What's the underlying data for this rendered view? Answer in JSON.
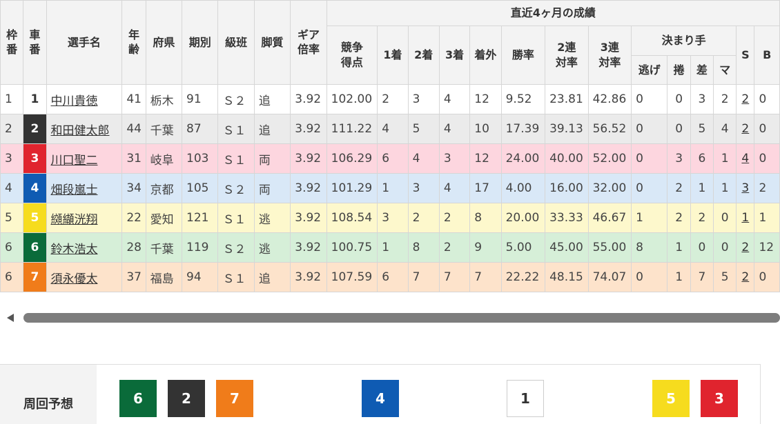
{
  "header": {
    "waku": "枠番",
    "sha": "車番",
    "name": "選手名",
    "age": "年齢",
    "pref": "府県",
    "term": "期別",
    "class": "級班",
    "style": "脚質",
    "gear": "ギア倍率",
    "recent": "直近4ヶ月の成績",
    "score": "競争得点",
    "first": "1着",
    "second": "2着",
    "third": "3着",
    "out": "着外",
    "win_rate": "勝率",
    "rate2": "2連対率",
    "rate3": "3連対率",
    "kimarite": "決まり手",
    "nige": "逃げ",
    "makuri": "捲",
    "sashi": "差",
    "ma": "マ",
    "s": "S",
    "b": "B"
  },
  "rows": [
    {
      "waku": "1",
      "car": "1",
      "name": "中川貴徳",
      "age": "41",
      "pref": "栃木",
      "term": "91",
      "class": "Ｓ２",
      "style": "追",
      "gear": "3.92",
      "score": "102.00",
      "p1": "2",
      "p2": "3",
      "p3": "4",
      "out": "12",
      "win": "9.52",
      "r2": "23.81",
      "r3": "42.86",
      "nige": "0",
      "makuri": "0",
      "sashi": "3",
      "ma": "2",
      "s": "2",
      "b": "0",
      "car_bg": "#ffffff",
      "car_fg": "#333333"
    },
    {
      "waku": "2",
      "car": "2",
      "name": "和田健太郎",
      "age": "44",
      "pref": "千葉",
      "term": "87",
      "class": "Ｓ１",
      "style": "追",
      "gear": "3.92",
      "score": "111.22",
      "p1": "4",
      "p2": "5",
      "p3": "4",
      "out": "10",
      "win": "17.39",
      "r2": "39.13",
      "r3": "56.52",
      "nige": "0",
      "makuri": "0",
      "sashi": "5",
      "ma": "4",
      "s": "2",
      "b": "0",
      "car_bg": "#333333",
      "car_fg": "#ffffff"
    },
    {
      "waku": "3",
      "car": "3",
      "name": "川口聖二",
      "age": "31",
      "pref": "岐阜",
      "term": "103",
      "class": "Ｓ１",
      "style": "両",
      "gear": "3.92",
      "score": "106.29",
      "p1": "6",
      "p2": "4",
      "p3": "3",
      "out": "12",
      "win": "24.00",
      "r2": "40.00",
      "r3": "52.00",
      "nige": "0",
      "makuri": "3",
      "sashi": "6",
      "ma": "1",
      "s": "4",
      "b": "0",
      "car_bg": "#e0242e",
      "car_fg": "#ffffff"
    },
    {
      "waku": "4",
      "car": "4",
      "name": "畑段嵐士",
      "age": "34",
      "pref": "京都",
      "term": "105",
      "class": "Ｓ２",
      "style": "両",
      "gear": "3.92",
      "score": "101.29",
      "p1": "1",
      "p2": "3",
      "p3": "4",
      "out": "17",
      "win": "4.00",
      "r2": "16.00",
      "r3": "32.00",
      "nige": "0",
      "makuri": "2",
      "sashi": "1",
      "ma": "1",
      "s": "3",
      "b": "2",
      "car_bg": "#0f5bb3",
      "car_fg": "#ffffff"
    },
    {
      "waku": "5",
      "car": "5",
      "name": "纐纈洸翔",
      "age": "22",
      "pref": "愛知",
      "term": "121",
      "class": "Ｓ１",
      "style": "逃",
      "gear": "3.92",
      "score": "108.54",
      "p1": "3",
      "p2": "2",
      "p3": "2",
      "out": "8",
      "win": "20.00",
      "r2": "33.33",
      "r3": "46.67",
      "nige": "1",
      "makuri": "2",
      "sashi": "2",
      "ma": "0",
      "s": "1",
      "b": "1",
      "car_bg": "#f6dc1e",
      "car_fg": "#ffffff"
    },
    {
      "waku": "6",
      "car": "6",
      "name": "鈴木浩太",
      "age": "28",
      "pref": "千葉",
      "term": "119",
      "class": "Ｓ２",
      "style": "逃",
      "gear": "3.92",
      "score": "100.75",
      "p1": "1",
      "p2": "8",
      "p3": "2",
      "out": "9",
      "win": "5.00",
      "r2": "45.00",
      "r3": "55.00",
      "nige": "8",
      "makuri": "1",
      "sashi": "0",
      "ma": "0",
      "s": "2",
      "b": "12",
      "car_bg": "#0a6b3a",
      "car_fg": "#ffffff"
    },
    {
      "waku": "6",
      "car": "7",
      "name": "須永優太",
      "age": "37",
      "pref": "福島",
      "term": "94",
      "class": "Ｓ１",
      "style": "追",
      "gear": "3.92",
      "score": "107.59",
      "p1": "6",
      "p2": "7",
      "p3": "7",
      "out": "7",
      "win": "22.22",
      "r2": "48.15",
      "r3": "74.07",
      "nige": "0",
      "makuri": "1",
      "sashi": "7",
      "ma": "5",
      "s": "2",
      "b": "0",
      "car_bg": "#f07c1a",
      "car_fg": "#ffffff"
    }
  ],
  "prediction": {
    "label": "周回予想",
    "boxes": [
      {
        "num": "6",
        "bg": "#0a6b3a",
        "fg": "#ffffff"
      },
      {
        "num": "2",
        "bg": "#333333",
        "fg": "#ffffff"
      },
      {
        "num": "7",
        "bg": "#f07c1a",
        "fg": "#ffffff"
      },
      {
        "num": "4",
        "bg": "#0f5bb3",
        "fg": "#ffffff"
      },
      {
        "num": "1",
        "bg": "#ffffff",
        "fg": "#333333"
      },
      {
        "num": "5",
        "bg": "#f6dc1e",
        "fg": "#ffffff"
      },
      {
        "num": "3",
        "bg": "#e0242e",
        "fg": "#ffffff"
      }
    ]
  }
}
